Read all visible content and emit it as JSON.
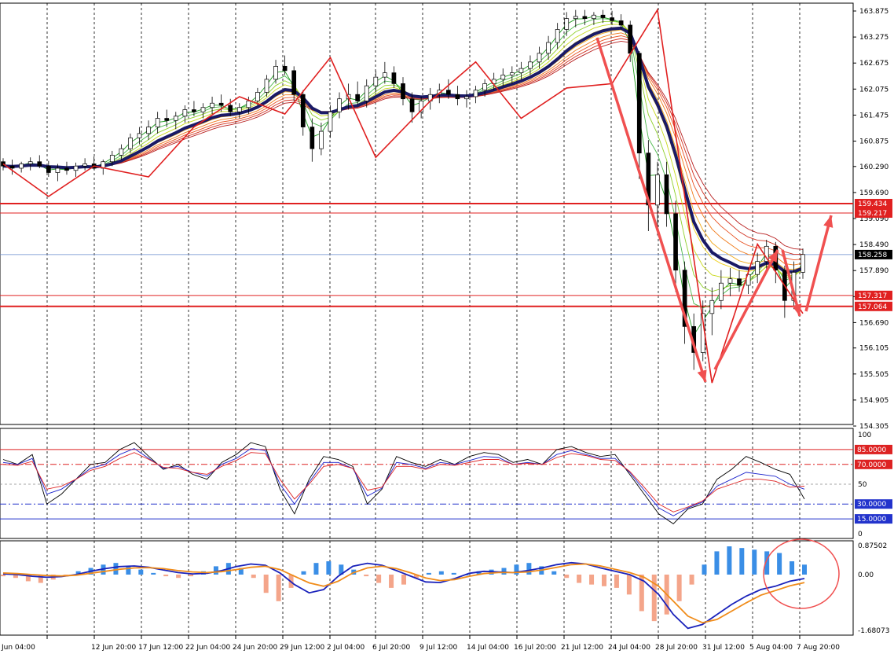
{
  "chart_data": [
    {
      "type": "candlestick",
      "panel": "price",
      "y_ticks": [
        "163.875",
        "163.275",
        "162.675",
        "162.075",
        "161.475",
        "160.875",
        "160.290",
        "159.690",
        "159.090",
        "158.490",
        "157.890",
        "157.290",
        "156.690",
        "156.105",
        "155.505",
        "154.905",
        "154.305"
      ],
      "ylim": [
        154.305,
        163.875
      ],
      "current_price": {
        "label": "158.258",
        "value": 158.258
      },
      "levels": [
        {
          "label": "159.434",
          "value": 159.434
        },
        {
          "label": "159.217",
          "value": 159.217
        },
        {
          "label": "157.317",
          "value": 157.317
        },
        {
          "label": "157.064",
          "value": 157.064
        }
      ],
      "x_labels": [
        "Jun 04:00",
        "12 Jun 20:00",
        "17 Jun 12:00",
        "22 Jun 04:00",
        "24 Jun 20:00",
        "29 Jun 12:00",
        "2 Jul 04:00",
        "6 Jul 20:00",
        "9 Jul 12:00",
        "14 Jul 04:00",
        "16 Jul 20:00",
        "21 Jul 12:00",
        "24 Jul 04:00",
        "28 Jul 20:00",
        "31 Jul 12:00",
        "5 Aug 04:00",
        "7 Aug 20:00"
      ],
      "zigzag": [
        [
          0,
          160.35
        ],
        [
          1,
          159.6
        ],
        [
          2,
          160.3
        ],
        [
          3,
          160.05
        ],
        [
          4,
          161.2
        ],
        [
          5,
          161.9
        ],
        [
          6,
          161.5
        ],
        [
          7,
          162.8
        ],
        [
          8,
          160.5
        ],
        [
          9,
          161.8
        ],
        [
          10,
          162.7
        ],
        [
          11,
          161.4
        ],
        [
          12,
          162.1
        ],
        [
          13,
          162.2
        ],
        [
          14,
          163.9
        ],
        [
          15,
          155.3
        ],
        [
          16,
          158.5
        ],
        [
          17,
          156.9
        ]
      ],
      "candles": [
        [
          160.4,
          160.48,
          160.2,
          160.3
        ],
        [
          160.3,
          160.45,
          160.1,
          160.25
        ],
        [
          160.25,
          160.4,
          160.15,
          160.35
        ],
        [
          160.35,
          160.5,
          160.2,
          160.4
        ],
        [
          160.4,
          160.55,
          160.25,
          160.3
        ],
        [
          160.3,
          160.42,
          160.05,
          160.15
        ],
        [
          160.15,
          160.35,
          159.95,
          160.25
        ],
        [
          160.25,
          160.4,
          160.1,
          160.2
        ],
        [
          160.2,
          160.38,
          160.05,
          160.3
        ],
        [
          160.3,
          160.48,
          160.2,
          160.35
        ],
        [
          160.35,
          160.52,
          160.22,
          160.25
        ],
        [
          160.25,
          160.45,
          160.1,
          160.4
        ],
        [
          160.4,
          160.65,
          160.3,
          160.55
        ],
        [
          160.55,
          160.8,
          160.45,
          160.7
        ],
        [
          160.7,
          161.05,
          160.6,
          160.95
        ],
        [
          160.95,
          161.2,
          160.8,
          161.05
        ],
        [
          161.05,
          161.35,
          160.9,
          161.2
        ],
        [
          161.2,
          161.55,
          161.05,
          161.4
        ],
        [
          161.4,
          161.6,
          161.2,
          161.35
        ],
        [
          161.35,
          161.55,
          161.15,
          161.45
        ],
        [
          161.45,
          161.7,
          161.3,
          161.6
        ],
        [
          161.6,
          161.8,
          161.45,
          161.55
        ],
        [
          161.55,
          161.75,
          161.4,
          161.65
        ],
        [
          161.65,
          161.9,
          161.5,
          161.75
        ],
        [
          161.75,
          161.95,
          161.55,
          161.7
        ],
        [
          161.7,
          161.85,
          161.45,
          161.55
        ],
        [
          161.55,
          161.75,
          161.4,
          161.65
        ],
        [
          161.65,
          161.9,
          161.5,
          161.8
        ],
        [
          161.8,
          162.1,
          161.7,
          162.0
        ],
        [
          162.0,
          162.4,
          161.9,
          162.3
        ],
        [
          162.3,
          162.75,
          162.2,
          162.6
        ],
        [
          162.6,
          162.85,
          162.4,
          162.5
        ],
        [
          162.5,
          162.6,
          161.8,
          161.95
        ],
        [
          161.95,
          162.05,
          161.0,
          161.2
        ],
        [
          161.2,
          161.4,
          160.4,
          160.7
        ],
        [
          160.7,
          161.3,
          160.55,
          161.1
        ],
        [
          161.1,
          161.7,
          160.95,
          161.55
        ],
        [
          161.55,
          162.0,
          161.4,
          161.85
        ],
        [
          161.85,
          162.2,
          161.6,
          161.95
        ],
        [
          161.95,
          162.25,
          161.7,
          161.8
        ],
        [
          161.8,
          162.3,
          161.65,
          162.15
        ],
        [
          162.15,
          162.5,
          162.0,
          162.35
        ],
        [
          162.35,
          162.7,
          162.2,
          162.45
        ],
        [
          162.45,
          162.6,
          162.1,
          162.2
        ],
        [
          162.2,
          162.35,
          161.7,
          161.85
        ],
        [
          161.85,
          162.0,
          161.3,
          161.55
        ],
        [
          161.55,
          161.9,
          161.4,
          161.8
        ],
        [
          161.8,
          162.1,
          161.6,
          161.95
        ],
        [
          161.95,
          162.2,
          161.75,
          162.05
        ],
        [
          162.05,
          162.3,
          161.85,
          161.95
        ],
        [
          161.95,
          162.15,
          161.7,
          161.85
        ],
        [
          161.85,
          162.05,
          161.65,
          161.9
        ],
        [
          161.9,
          162.15,
          161.75,
          162.05
        ],
        [
          162.05,
          162.3,
          161.9,
          162.2
        ],
        [
          162.2,
          162.45,
          162.05,
          162.3
        ],
        [
          162.3,
          162.55,
          162.15,
          162.4
        ],
        [
          162.4,
          162.6,
          162.2,
          162.45
        ],
        [
          162.45,
          162.7,
          162.3,
          162.55
        ],
        [
          162.55,
          162.85,
          162.4,
          162.7
        ],
        [
          162.7,
          163.05,
          162.55,
          162.9
        ],
        [
          162.9,
          163.3,
          162.75,
          163.15
        ],
        [
          163.15,
          163.6,
          163.0,
          163.45
        ],
        [
          163.45,
          163.85,
          163.3,
          163.7
        ],
        [
          163.7,
          163.9,
          163.5,
          163.75
        ],
        [
          163.75,
          163.9,
          163.55,
          163.7
        ],
        [
          163.7,
          163.85,
          163.55,
          163.78
        ],
        [
          163.78,
          163.9,
          163.6,
          163.72
        ],
        [
          163.72,
          163.88,
          163.55,
          163.65
        ],
        [
          163.65,
          163.8,
          163.45,
          163.55
        ],
        [
          163.55,
          163.65,
          162.7,
          162.9
        ],
        [
          162.9,
          162.95,
          160.0,
          160.6
        ],
        [
          160.6,
          160.9,
          158.8,
          159.4
        ],
        [
          159.4,
          160.4,
          158.7,
          160.1
        ],
        [
          160.1,
          160.4,
          158.9,
          159.2
        ],
        [
          159.2,
          159.5,
          157.4,
          157.9
        ],
        [
          157.9,
          158.1,
          156.2,
          156.6
        ],
        [
          156.6,
          156.9,
          155.6,
          156.0
        ],
        [
          156.0,
          157.2,
          155.8,
          156.9
        ],
        [
          156.9,
          157.5,
          156.4,
          157.2
        ],
        [
          157.2,
          157.9,
          157.0,
          157.6
        ],
        [
          157.6,
          157.95,
          157.3,
          157.7
        ],
        [
          157.7,
          157.9,
          157.4,
          157.55
        ],
        [
          157.55,
          157.95,
          157.35,
          157.8
        ],
        [
          157.8,
          158.3,
          157.6,
          158.1
        ],
        [
          158.1,
          158.6,
          157.9,
          158.45
        ],
        [
          158.45,
          158.55,
          157.6,
          157.9
        ],
        [
          157.9,
          158.0,
          156.8,
          157.2
        ],
        [
          157.2,
          158.1,
          157.0,
          157.85
        ],
        [
          157.85,
          158.4,
          157.7,
          158.26
        ]
      ]
    },
    {
      "type": "line",
      "panel": "stochastic-oscillator",
      "y_ticks": [
        "100",
        "50",
        "0"
      ],
      "ylim": [
        0,
        100
      ],
      "levels": [
        {
          "label": "85.0000",
          "value": 85,
          "color": "#dd2222"
        },
        {
          "label": "70.0000",
          "value": 70,
          "color": "#dd2222"
        },
        {
          "label": "30.0000",
          "value": 30,
          "color": "#2233cc"
        },
        {
          "label": "15.0000",
          "value": 15,
          "color": "#2233cc"
        }
      ],
      "series": [
        {
          "color": "#000000",
          "values": [
            75,
            70,
            80,
            30,
            40,
            55,
            70,
            72,
            85,
            92,
            78,
            65,
            70,
            60,
            55,
            72,
            80,
            92,
            88,
            45,
            20,
            55,
            78,
            75,
            68,
            30,
            45,
            78,
            72,
            68,
            75,
            70,
            78,
            82,
            80,
            72,
            75,
            70,
            85,
            88,
            82,
            78,
            80,
            60,
            40,
            20,
            10,
            25,
            30,
            55,
            65,
            78,
            72,
            65,
            60,
            35
          ]
        },
        {
          "color": "#1a22cc",
          "values": [
            72,
            70,
            76,
            40,
            45,
            55,
            66,
            70,
            80,
            86,
            76,
            66,
            68,
            62,
            58,
            70,
            76,
            86,
            84,
            50,
            30,
            52,
            72,
            72,
            66,
            38,
            46,
            72,
            70,
            66,
            72,
            70,
            74,
            78,
            77,
            70,
            72,
            70,
            80,
            84,
            80,
            76,
            76,
            62,
            44,
            26,
            18,
            26,
            32,
            48,
            55,
            62,
            60,
            58,
            50,
            45
          ]
        },
        {
          "color": "#dd2222",
          "values": [
            70,
            69,
            73,
            45,
            48,
            55,
            64,
            68,
            76,
            82,
            75,
            67,
            66,
            62,
            60,
            68,
            74,
            82,
            81,
            55,
            35,
            50,
            68,
            70,
            66,
            44,
            47,
            68,
            68,
            65,
            70,
            69,
            72,
            75,
            75,
            70,
            71,
            70,
            77,
            81,
            79,
            75,
            74,
            63,
            47,
            30,
            22,
            27,
            33,
            45,
            50,
            55,
            55,
            53,
            47,
            48
          ]
        }
      ]
    },
    {
      "type": "bar",
      "panel": "macd",
      "y_ticks": [
        "0.87502",
        "0.00",
        "-1.68073"
      ],
      "ylim": [
        -1.68073,
        0.87502
      ],
      "histogram": [
        -0.05,
        -0.1,
        -0.2,
        -0.25,
        -0.15,
        -0.05,
        0.1,
        0.2,
        0.3,
        0.35,
        0.25,
        0.15,
        0.05,
        -0.05,
        -0.1,
        -0.05,
        0.1,
        0.25,
        0.35,
        0.2,
        -0.1,
        -0.55,
        -0.8,
        -0.4,
        0.1,
        0.35,
        0.4,
        0.3,
        0.15,
        -0.05,
        -0.25,
        -0.4,
        -0.3,
        -0.1,
        0.05,
        0.1,
        0.05,
        0.0,
        0.1,
        0.15,
        0.2,
        0.3,
        0.35,
        0.25,
        0.1,
        -0.1,
        -0.25,
        -0.3,
        -0.35,
        -0.4,
        -0.6,
        -1.1,
        -1.4,
        -1.2,
        -0.8,
        -0.3,
        0.3,
        0.7,
        0.85,
        0.8,
        0.75,
        0.7,
        0.65,
        0.4,
        0.3
      ],
      "series": [
        {
          "color": "#1a22bb",
          "values": [
            0.02,
            0.0,
            -0.05,
            -0.08,
            -0.06,
            0.0,
            0.1,
            0.18,
            0.24,
            0.26,
            0.22,
            0.14,
            0.06,
            0.02,
            0.04,
            0.12,
            0.24,
            0.32,
            0.28,
            0.05,
            -0.3,
            -0.55,
            -0.45,
            -0.05,
            0.25,
            0.34,
            0.28,
            0.12,
            -0.05,
            -0.22,
            -0.24,
            -0.12,
            0.04,
            0.1,
            0.08,
            0.06,
            0.12,
            0.2,
            0.3,
            0.36,
            0.32,
            0.2,
            0.1,
            0.0,
            -0.2,
            -0.6,
            -1.2,
            -1.62,
            -1.5,
            -1.2,
            -0.9,
            -0.65,
            -0.45,
            -0.35,
            -0.2,
            -0.12
          ]
        },
        {
          "color": "#f08c1a",
          "values": [
            0.05,
            0.03,
            0.0,
            -0.03,
            -0.04,
            -0.02,
            0.04,
            0.1,
            0.16,
            0.2,
            0.21,
            0.18,
            0.12,
            0.08,
            0.06,
            0.09,
            0.15,
            0.22,
            0.25,
            0.15,
            -0.05,
            -0.25,
            -0.35,
            -0.2,
            0.05,
            0.2,
            0.25,
            0.18,
            0.05,
            -0.1,
            -0.18,
            -0.15,
            -0.05,
            0.03,
            0.06,
            0.06,
            0.08,
            0.14,
            0.22,
            0.3,
            0.32,
            0.26,
            0.16,
            0.06,
            -0.08,
            -0.35,
            -0.8,
            -1.25,
            -1.45,
            -1.35,
            -1.1,
            -0.85,
            -0.62,
            -0.48,
            -0.34,
            -0.24
          ]
        }
      ]
    }
  ]
}
